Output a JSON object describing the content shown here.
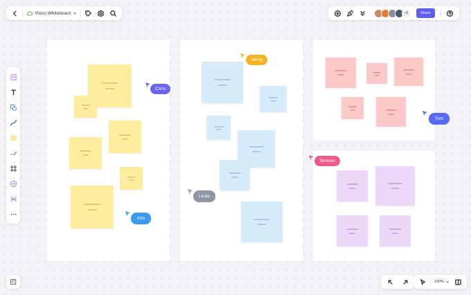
{
  "header": {
    "title": "Pixso Whiteboard",
    "share_label": "Share",
    "more_count": "+8"
  },
  "zoom": {
    "level": "100%"
  },
  "colors": {
    "accent": "#5d5fef",
    "yellow_note": "#fdee9f",
    "blue_note": "#d6ecfb",
    "red_note": "#fcc8c8",
    "purple_note": "#ecd9fa"
  },
  "cursors": {
    "chris": {
      "name": "Chris",
      "color": "#6c63ef"
    },
    "jenny": {
      "name": "Jenny",
      "color": "#f2b51f"
    },
    "tom": {
      "name": "Tom",
      "color": "#5569f2"
    },
    "kim": {
      "name": "Kim",
      "color": "#3a9af0"
    },
    "linda": {
      "name": "Linda",
      "color": "#8d96a3"
    },
    "tomson": {
      "name": "Tomson",
      "color": "#ee5a8c"
    }
  },
  "sidebar": {
    "tools": [
      "sticky-note-icon",
      "text-icon",
      "shape-icon",
      "connector-icon",
      "note-icon",
      "pen-icon",
      "frame-icon",
      "template-icon",
      "more-icon"
    ]
  },
  "icons": {
    "back": "back-icon",
    "tag": "tag-icon",
    "settings": "settings-icon",
    "search": "search-icon",
    "add": "add-icon",
    "celebrate": "celebrate-icon",
    "collapse": "chevrons-icon",
    "help": "help-icon",
    "undo": "undo-icon",
    "redo": "redo-icon",
    "pointer": "pointer-icon",
    "map": "minimap-icon",
    "layers": "layers-icon"
  }
}
